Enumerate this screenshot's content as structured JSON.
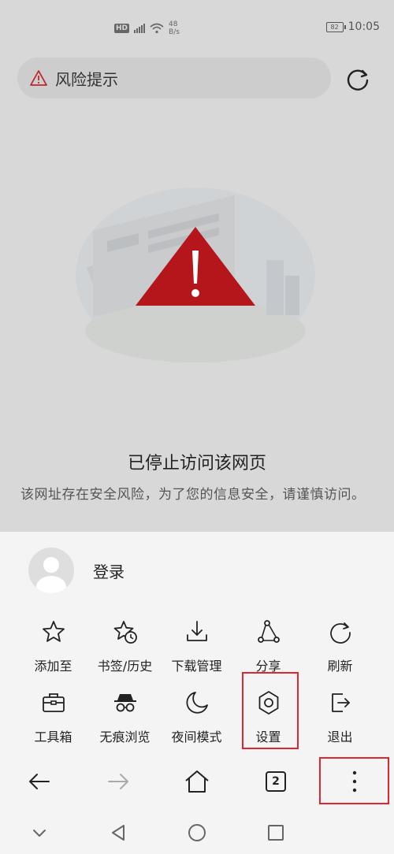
{
  "status_bar": {
    "hd": "HD",
    "net_speed_value": "48",
    "net_speed_unit": "B/s",
    "battery_level": "82",
    "time": "10:05"
  },
  "address_bar": {
    "text": "风险提示",
    "left_icon": "warning-triangle-icon",
    "right_icon": "reload-icon"
  },
  "error": {
    "title": "已停止访问该网页",
    "description": "该网址存在安全风险，为了您的信息安全，请谨慎访问。"
  },
  "menu": {
    "login_label": "登录",
    "rows": [
      [
        {
          "label": "添加至",
          "icon": "star-icon"
        },
        {
          "label": "书签/历史",
          "icon": "bookmark-history-icon"
        },
        {
          "label": "下载管理",
          "icon": "download-icon"
        },
        {
          "label": "分享",
          "icon": "share-icon"
        },
        {
          "label": "刷新",
          "icon": "refresh-icon"
        }
      ],
      [
        {
          "label": "工具箱",
          "icon": "toolbox-icon"
        },
        {
          "label": "无痕浏览",
          "icon": "incognito-icon"
        },
        {
          "label": "夜间模式",
          "icon": "moon-icon"
        },
        {
          "label": "设置",
          "icon": "gear-icon"
        },
        {
          "label": "退出",
          "icon": "exit-icon"
        }
      ]
    ]
  },
  "bottom_nav": {
    "tab_count": "2"
  },
  "colors": {
    "highlight": "#e0252f",
    "warning_red": "#b5161c",
    "overlay_gray": "#d8d8d8"
  }
}
